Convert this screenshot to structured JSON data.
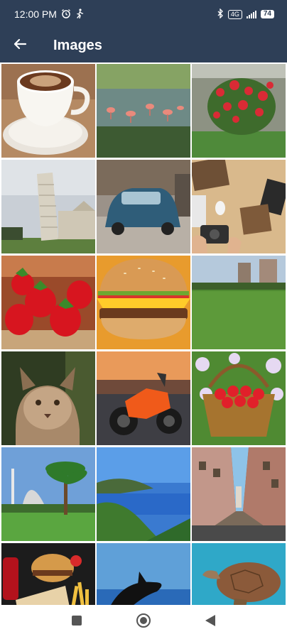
{
  "status_bar": {
    "time": "12:00 PM",
    "alarm_icon": "alarm-clock-icon",
    "activity_icon": "walking-person-icon",
    "bluetooth_icon": "bluetooth-icon",
    "network_badge": "4G",
    "battery_level": "74"
  },
  "app_bar": {
    "back_icon": "arrow-left-icon",
    "title": "Images"
  },
  "gallery": {
    "images": [
      "coffee-cup",
      "flamingo-pond",
      "rose-bush",
      "leaning-tower-pisa",
      "vintage-blue-car",
      "desk-flatlay",
      "strawberries",
      "cheeseburger",
      "city-park",
      "lynx",
      "orange-motorcycle",
      "strawberry-basket",
      "istanbul-palm",
      "coastal-bay",
      "narrow-street",
      "fast-food",
      "orca-jump",
      "sea-turtle"
    ]
  },
  "nav_bar": {
    "recents_icon": "square-recents-icon",
    "home_icon": "circle-home-icon",
    "back_icon": "triangle-back-icon"
  }
}
